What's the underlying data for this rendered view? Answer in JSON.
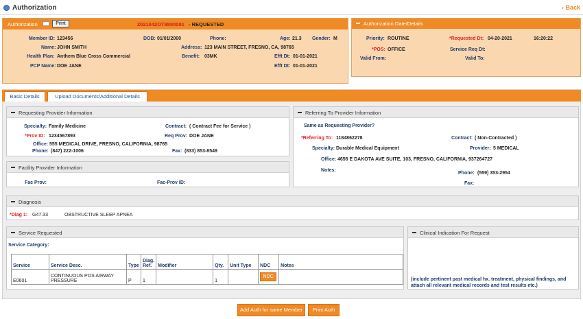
{
  "header": {
    "title": "Authorization",
    "back_label": "Back"
  },
  "auth_bar": {
    "label": "Authorization",
    "print_label": "Print",
    "auth_number": "2021042OT8800001",
    "status": " - REQUESTED"
  },
  "member": {
    "member_id_label": "Member ID:",
    "member_id": "123456",
    "dob_label": "DOB:",
    "dob": "01/01/2000",
    "phone_label": "Phone:",
    "phone": "",
    "age_label": "Age:",
    "age": "21.3",
    "gender_label": "Gender:",
    "gender": "M",
    "name_label": "Name:",
    "name": "JOHN SMITH",
    "address_label": "Address:",
    "address": "123 MAIN STREET, FRESNO, CA, 98765",
    "plan_label": "Health Plan:",
    "plan": "Anthem Blue Cross Commercial",
    "benefit_label": "Benefit:",
    "benefit": "03MK",
    "efft1_label": "Efft Dt:",
    "efft1": "01-01-2021",
    "pcp_label": "PCP Name:",
    "pcp": "DOE JANE",
    "efft2_label": "Efft Dt:",
    "efft2": "01-01-2021"
  },
  "auth_details": {
    "title": "Authorization Date/Details",
    "priority_label": "Priority:",
    "priority": "ROUTINE",
    "requested_dt_label": "*Requested Dt:",
    "requested_dt": "04-20-2021",
    "requested_time": "16:20:22",
    "pos_label": "*POS:",
    "pos": "OFFICE",
    "service_req_label": "Service Req Dt:",
    "valid_from_label": "Valid From:",
    "valid_to_label": "Valid To:"
  },
  "tabs": [
    {
      "label": "Basic Details"
    },
    {
      "label": "Upload Documents/Additional Details"
    }
  ],
  "requesting": {
    "title": "Requesting Provider Information",
    "specialty_label": "Specialty:",
    "specialty": "Family Medicine",
    "contract_label": "Contract:",
    "contract": "( Contract Fee for Service )",
    "prov_id_label": "*Prov ID:",
    "prov_id": "1234567893",
    "req_prov_label": "Req Prov:",
    "req_prov": "DOE JANE",
    "office_label": "Office:",
    "office": "555 MEDICAL DRIVE, FRESNO, CALIFORNIA, 98765",
    "phone_label": "Phone:",
    "phone": "(847) 222-1006",
    "fax_label": "Fax:",
    "fax": "(833) 853-8549"
  },
  "referring": {
    "title": "Referring To Provider Information",
    "same_as_label": "Same as Requesting Provider?",
    "ref_to_label": "*Referring To:",
    "ref_to": "1184862278",
    "contract_label": "Contract:",
    "contract": "( Non-Contracted )",
    "specialty_label": "Specialty:",
    "specialty": "Durable Medical Equipment",
    "provider_label": "Provider:",
    "provider": "5 MEDICAL",
    "office_label": "Office:",
    "office": "4656 E DAKOTA AVE SUITE, 103, FRESNO, CALIFORNIA, 937264727",
    "notes_label": "Notes:",
    "phone_label": "Phone:",
    "phone": "(559) 353-2954",
    "fax_label": "Fax:"
  },
  "facility": {
    "title": "Facility Provider Information",
    "fac_prov_label": "Fac Prov:",
    "fac_prov_id_label": "Fac-Prov ID:"
  },
  "diagnosis": {
    "title": "Diagnosis",
    "diag1_label": "*Diag 1:",
    "diag1_code": "G47.33",
    "diag1_desc": "OBSTRUCTIVE SLEEP APNEA"
  },
  "service": {
    "title": "Service Requested",
    "category_label": "Service Category:",
    "columns": [
      "Service",
      "Service Desc.",
      "Type",
      "Diag. Ref.",
      "Modifier",
      "Qty.",
      "Unit Type",
      "NDC",
      "Notes"
    ],
    "row": {
      "service": "E0601",
      "desc": "CONTINUOUS POS AIRWAY PRESSURE",
      "type": "P",
      "diag_ref": "1",
      "modifier": "",
      "qty": "1",
      "unit_type": "",
      "ndc_button": "NDC",
      "notes": ""
    }
  },
  "clinical": {
    "title": "Clinical Indication For Request",
    "hint": "(include pertinent past medical hx. treatment, physical findings, and attach all relevant medical records and test results etc.)"
  },
  "actions": {
    "add_auth": "Add Auth for same Member",
    "print_auth": "Print Auth"
  },
  "colors": {
    "accent": "#f08a24",
    "member_bg": "#fbd7b0",
    "label_blue": "#1f3a6b",
    "required_red": "#e02020"
  }
}
